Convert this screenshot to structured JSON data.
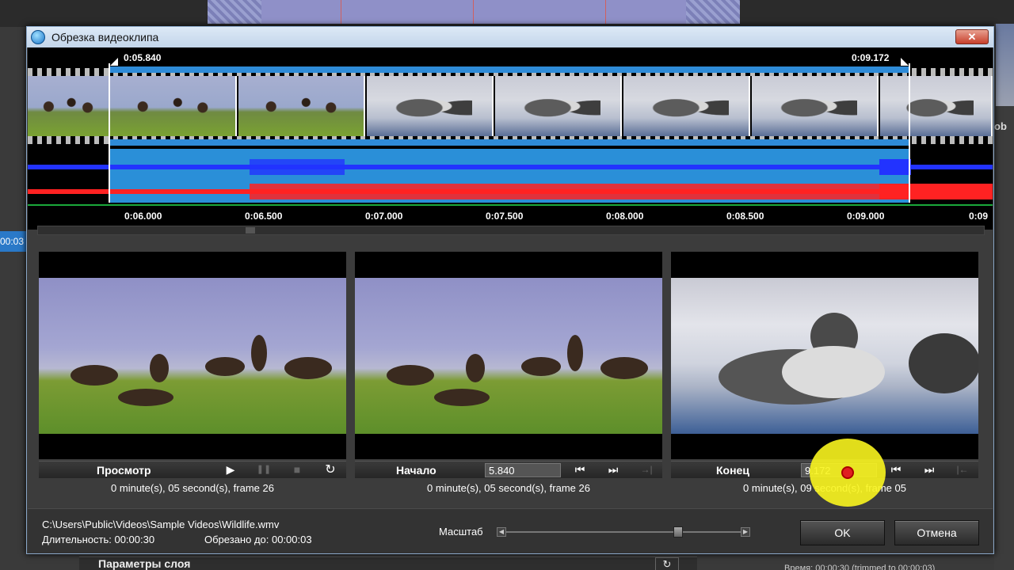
{
  "background": {
    "left_time": "00:03",
    "right_label": "ob",
    "bottom_panel_title": "Параметры слоя",
    "bottom_right_text": "Время: 00:00:30 (trimmed to 00:00:03)"
  },
  "dialog": {
    "title": "Обрезка видеоклипа",
    "close_label": "✕"
  },
  "timeline": {
    "start_label": "0:05.840",
    "end_label": "0:09.172",
    "ruler": [
      "0:06.000",
      "0:06.500",
      "0:07.000",
      "0:07.500",
      "0:08.000",
      "0:08.500",
      "0:09.000",
      "0:09"
    ]
  },
  "panels": {
    "preview": {
      "label": "Просмотр",
      "status": "0 minute(s), 05 second(s), frame 26"
    },
    "start": {
      "label": "Начало",
      "value": "5.840",
      "status": "0 minute(s), 05 second(s), frame 26"
    },
    "end": {
      "label": "Конец",
      "value": "9.172",
      "status": "0 minute(s), 09 second(s), frame 05"
    }
  },
  "footer": {
    "path": "C:\\Users\\Public\\Videos\\Sample Videos\\Wildlife.wmv",
    "duration": "Длительность: 00:00:30",
    "trimmed": "Обрезано до: 00:00:03",
    "zoom_label": "Масштаб",
    "zoom_level": 0.76,
    "ok": "OK",
    "cancel": "Отмена"
  },
  "icons": {
    "play": "▶",
    "pause": "❚❚",
    "stop": "■",
    "loop": "↻",
    "to_start": "⏮",
    "to_end": "⏭",
    "set_in": "→|",
    "set_out": "|←"
  }
}
